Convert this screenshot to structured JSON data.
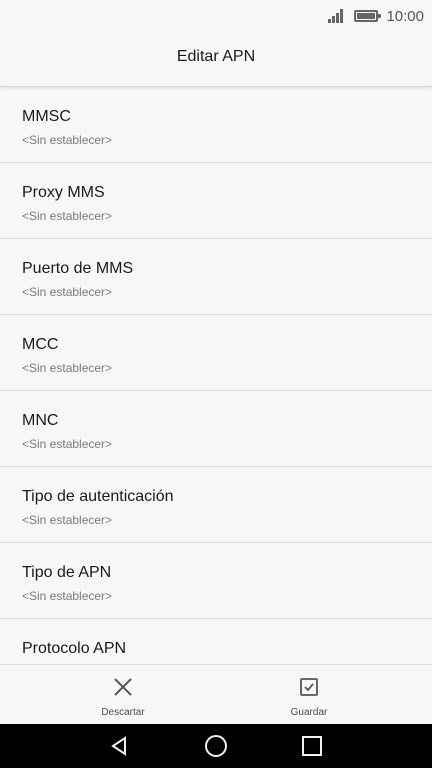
{
  "status": {
    "time": "10:00",
    "icons": [
      "signal-icon",
      "battery-icon"
    ]
  },
  "title": "Editar APN",
  "items": [
    {
      "label": "MMSC",
      "value": "<Sin establecer>"
    },
    {
      "label": "Proxy MMS",
      "value": "<Sin establecer>"
    },
    {
      "label": "Puerto de MMS",
      "value": "<Sin establecer>"
    },
    {
      "label": "MCC",
      "value": "<Sin establecer>"
    },
    {
      "label": "MNC",
      "value": "<Sin establecer>"
    },
    {
      "label": "Tipo de autenticación",
      "value": "<Sin establecer>"
    },
    {
      "label": "Tipo de APN",
      "value": "<Sin establecer>"
    },
    {
      "label": "Protocolo APN",
      "value": ""
    }
  ],
  "actions": {
    "discard_label": "Descartar",
    "save_label": "Guardar",
    "discard_icon": "close-icon",
    "save_icon": "checkbox-check-icon"
  },
  "nav": {
    "back_icon": "back-triangle-icon",
    "home_icon": "home-circle-icon",
    "recents_icon": "recents-square-icon"
  },
  "colors": {
    "background": "#f7f7f7",
    "navbar": "#000000",
    "secondary_text": "#7a7a7a"
  }
}
